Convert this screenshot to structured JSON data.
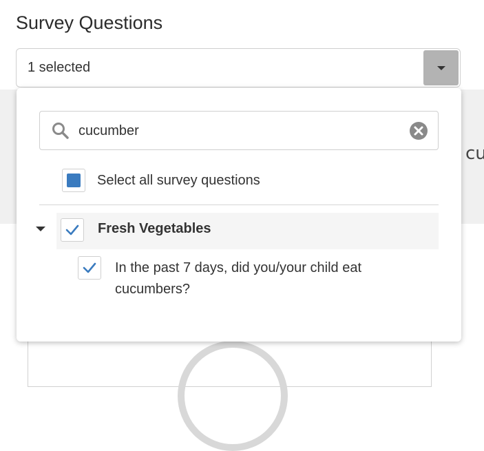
{
  "page": {
    "title": "Survey Questions",
    "background_partial_text": "cu"
  },
  "select": {
    "value": "1 selected"
  },
  "dropdown": {
    "search": {
      "value": "cucumber",
      "placeholder": ""
    },
    "select_all": {
      "label": "Select all survey questions",
      "state": "indeterminate"
    },
    "groups": [
      {
        "label": "Fresh Vegetables",
        "expanded": true,
        "checked": true,
        "items": [
          {
            "label": "In the past 7 days, did you/your child eat cucumbers?",
            "checked": true
          }
        ]
      }
    ]
  },
  "colors": {
    "accent": "#3a7bbf",
    "check": "#3a7bbf",
    "arrow_bg": "#b3b3b3",
    "border": "#cfcfcf",
    "group_row_bg": "#f5f5f5"
  },
  "icons": {
    "search": "search-icon",
    "clear": "clear-icon",
    "caret": "caret-down-icon",
    "check": "checkmark-icon"
  }
}
